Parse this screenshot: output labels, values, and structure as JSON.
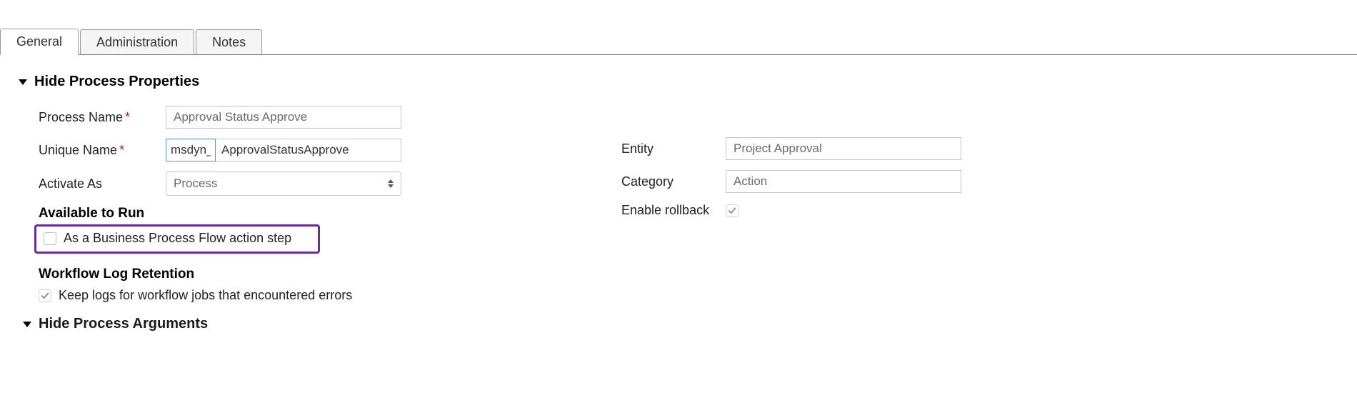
{
  "tabs": {
    "general": "General",
    "administration": "Administration",
    "notes": "Notes"
  },
  "sections": {
    "properties_toggle": "Hide Process Properties",
    "arguments_toggle": "Hide Process Arguments"
  },
  "left": {
    "process_name_label": "Process Name",
    "process_name_value": "Approval Status Approve",
    "unique_name_label": "Unique Name",
    "unique_name_prefix": "msdyn_",
    "unique_name_value": "ApprovalStatusApprove",
    "activate_as_label": "Activate As",
    "activate_as_value": "Process",
    "available_to_run": "Available to Run",
    "as_bpf_step": "As a Business Process Flow action step",
    "workflow_log_retention": "Workflow Log Retention",
    "keep_logs": "Keep logs for workflow jobs that encountered errors"
  },
  "right": {
    "entity_label": "Entity",
    "entity_value": "Project Approval",
    "category_label": "Category",
    "category_value": "Action",
    "enable_rollback_label": "Enable rollback"
  }
}
